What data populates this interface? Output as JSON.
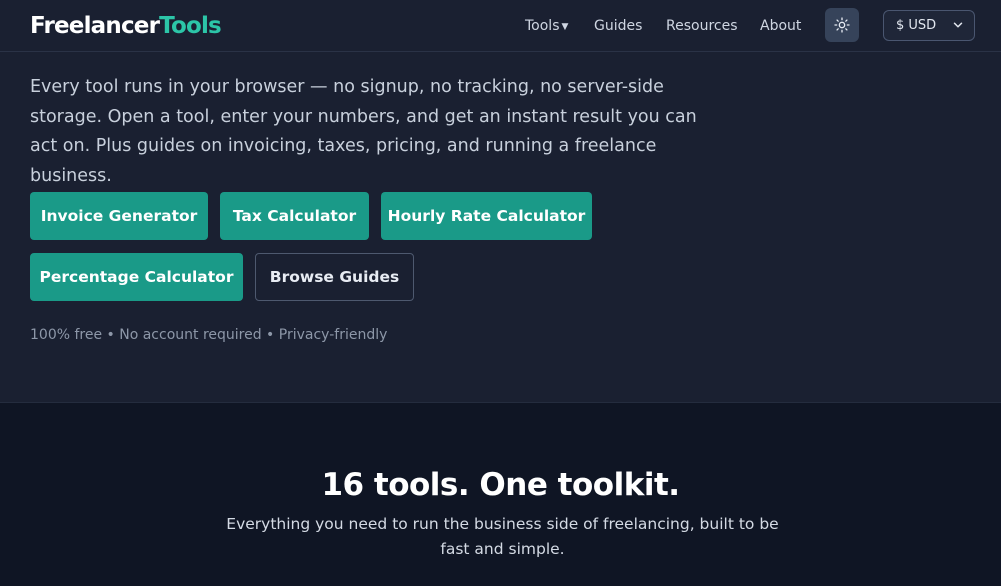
{
  "header": {
    "logo_part1": "Freelancer",
    "logo_part2": "Tools",
    "nav": {
      "tools": "Tools",
      "guides": "Guides",
      "resources": "Resources",
      "about": "About"
    },
    "theme_icon": "sun-icon",
    "currency": "$ USD"
  },
  "hero": {
    "description": "Every tool runs in your browser — no signup, no tracking, no server-side storage. Open a tool, enter your numbers, and get an instant result you can act on. Plus guides on invoicing, taxes, pricing, and running a freelance business.",
    "buttons": {
      "invoice": "Invoice Generator",
      "tax": "Tax Calculator",
      "hourly": "Hourly Rate Calculator",
      "percentage": "Percentage Calculator",
      "guides": "Browse Guides"
    },
    "tagline": "100% free • No account required • Privacy-friendly"
  },
  "tools_section": {
    "title": "16 tools. One toolkit.",
    "subtitle": "Everything you need to run the business side of freelancing, built to be fast and simple."
  },
  "colors": {
    "accent": "#1a9a88",
    "logo_accent": "#2cc5a8",
    "background": "#1a2031",
    "section_background": "#0f1524"
  }
}
